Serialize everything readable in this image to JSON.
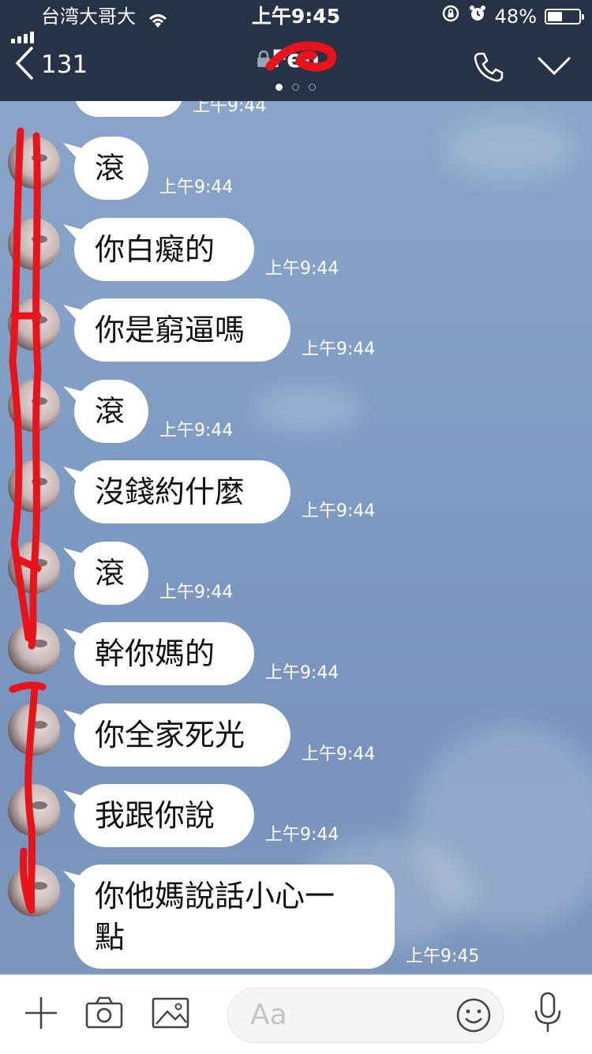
{
  "status_bar": {
    "carrier": "台湾大哥大",
    "time": "上午9:45",
    "battery": "48%",
    "battery_level": 0.48
  },
  "header": {
    "back_count": "131",
    "title": "Fen",
    "page_dots": 3,
    "active_dot": 0,
    "icons": [
      "back-chevron-icon",
      "lock-icon",
      "phone-icon",
      "chevron-down-icon"
    ]
  },
  "chat": {
    "top_partial_time": "上午9:44",
    "messages": [
      {
        "text": "滾",
        "time": "上午9:44"
      },
      {
        "text": "你白癡的",
        "time": "上午9:44"
      },
      {
        "text": "你是窮逼嗎",
        "time": "上午9:44"
      },
      {
        "text": "滾",
        "time": "上午9:44"
      },
      {
        "text": "沒錢約什麼",
        "time": "上午9:44"
      },
      {
        "text": "滾",
        "time": "上午9:44"
      },
      {
        "text": "幹你媽的",
        "time": "上午9:44"
      },
      {
        "text": "你全家死光",
        "time": "上午9:44"
      },
      {
        "text": "我跟你說",
        "time": "上午9:44"
      },
      {
        "text": "你他媽說話小心一\n點",
        "time": "上午9:45"
      }
    ]
  },
  "input_bar": {
    "placeholder": "Aa",
    "icons": [
      "plus-icon",
      "camera-icon",
      "image-icon",
      "emoji-icon",
      "microphone-icon"
    ]
  },
  "colors": {
    "header_bg": "#283246",
    "chat_bg": "#7f9cc4",
    "annotation_red": "#e8141c"
  }
}
